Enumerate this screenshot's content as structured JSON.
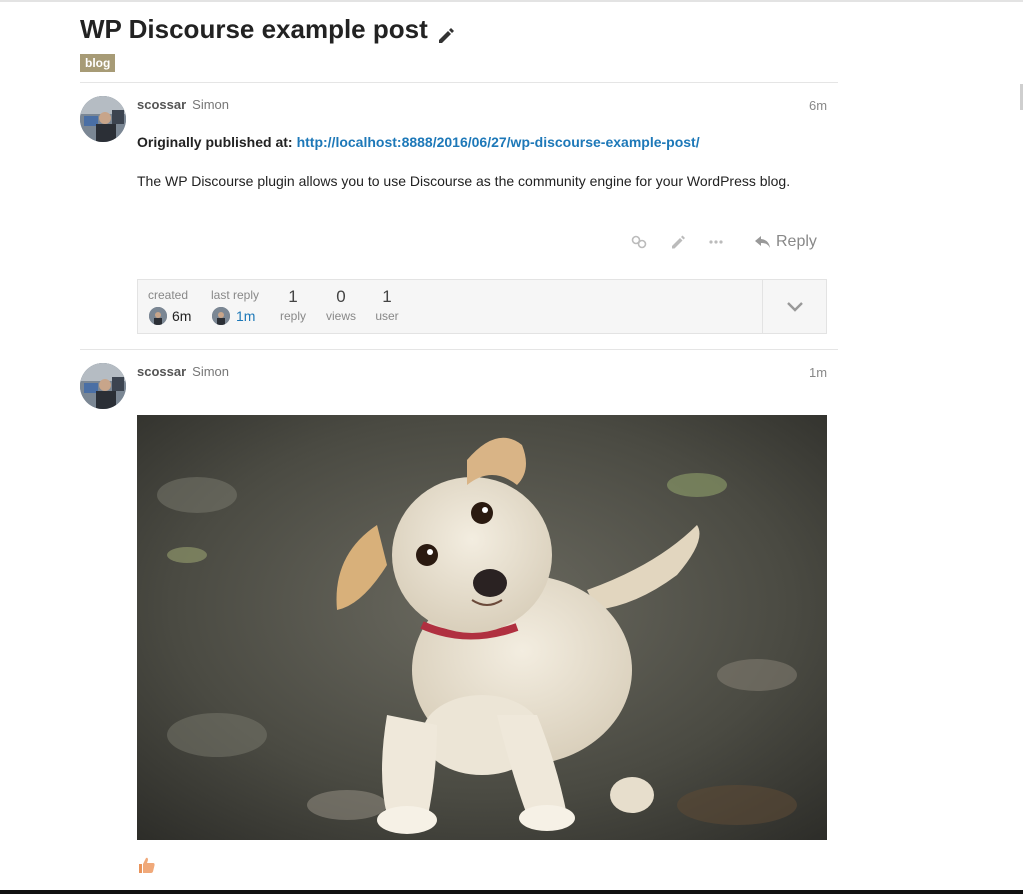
{
  "topic": {
    "title": "WP Discourse example post",
    "category": "blog",
    "category_color": "#a79b76"
  },
  "posts": [
    {
      "username": "scossar",
      "full_name": "Simon",
      "time": "6m",
      "originally_published_label": "Originally published at:",
      "originally_published_url": "http://localhost:8888/2016/06/27/wp-discourse-example-post/",
      "body": "The WP Discourse plugin allows you to use Discourse as the community engine for your WordPress blog.",
      "actions": {
        "icons": [
          "link-icon",
          "pencil-icon",
          "ellipsis-icon"
        ],
        "reply_label": "Reply"
      }
    },
    {
      "username": "scossar",
      "full_name": "Simon",
      "time": "1m",
      "image": "puppy-photo",
      "reaction_icon": "thumbs-up-icon"
    }
  ],
  "topic_map": {
    "created_label": "created",
    "created_value": "6m",
    "last_reply_label": "last reply",
    "last_reply_value": "1m",
    "stats": [
      {
        "value": "1",
        "label": "reply"
      },
      {
        "value": "0",
        "label": "views"
      },
      {
        "value": "1",
        "label": "user"
      }
    ],
    "expand_icon": "chevron-down-icon"
  },
  "colors": {
    "link": "#1d78b8",
    "muted": "#888888",
    "reaction": "#e9935a"
  }
}
